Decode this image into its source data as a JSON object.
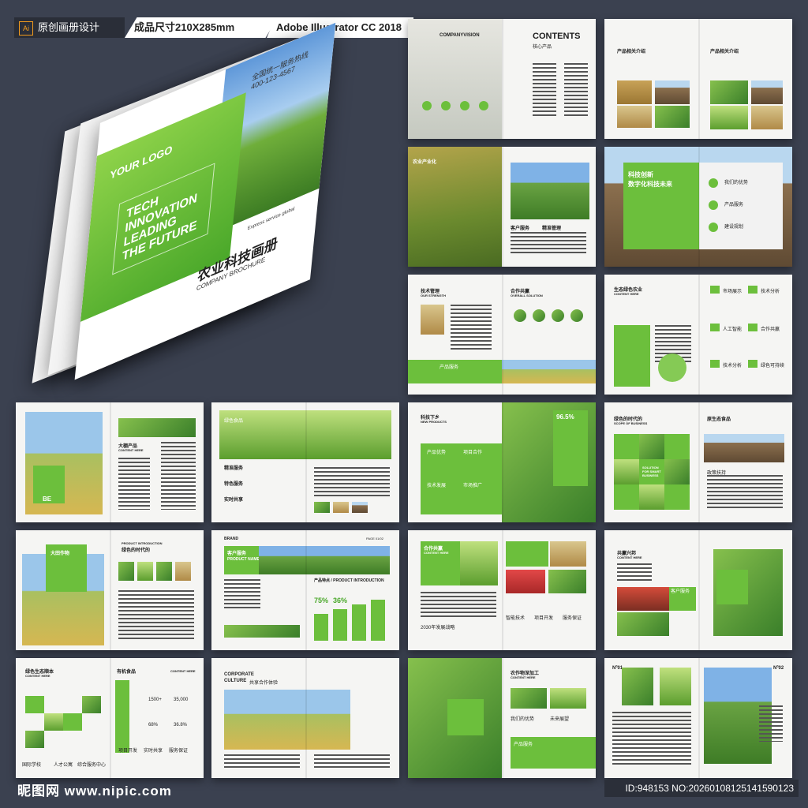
{
  "header": {
    "tag_ai": "Ai",
    "tag_design": "原创画册设计",
    "tag_size": "成品尺寸210X285mm",
    "tag_software": "Adobe Illustrator CC 2018"
  },
  "cover": {
    "logo": "YOUR LOGO",
    "slogan": "TECH INNOVATION LEADING THE FUTURE",
    "title_cn": "农业科技画册",
    "subtitle": "COMPANY BROCHURE",
    "phone_label": "全国统一服务热线",
    "phone": "400-123-4567",
    "express": "Express service global"
  },
  "spreads": {
    "s1": {
      "left_title": "COMPANYVISION",
      "right_title": "CONTENTS",
      "right_sub": "核心产品"
    },
    "s2": {
      "left_title": "产品相关介绍",
      "right_title": "产品相关介绍"
    },
    "s3": {
      "title": "农业产业化",
      "c1": "客户服务",
      "c2": "精准管理"
    },
    "s4": {
      "title1": "科技创新",
      "title2": "数字化科技未来",
      "i1": "我们的优势",
      "i2": "产品服务",
      "i3": "建设规划"
    },
    "s5": {
      "left_title": "技术管理",
      "left_sub": "OUR STRENGTH",
      "right_title": "合作共赢",
      "right_sub": "OVERALL SOLUTION",
      "label": "产品服务"
    },
    "s6": {
      "title": "生态绿色农业",
      "sub": "CONTENT HERE",
      "a": "市场展示",
      "b": "技术分析",
      "c": "人工智能",
      "d": "合作共赢",
      "e": "技术分析",
      "f": "绿色可持续"
    },
    "s7": {
      "title": "大棚产品",
      "sub": "CONTENT HERE",
      "badge": "BE"
    },
    "s8": {
      "title": "绿色食品",
      "a": "精准服务",
      "b": "特色服务",
      "c": "实时共享"
    },
    "s9": {
      "title": "科技下乡",
      "sub": "NEW PRODUCTS",
      "pct": "96.5%",
      "a": "产品优势",
      "b": "项目合作",
      "c": "技术发展",
      "d": "市场推广"
    },
    "s10": {
      "title": "绿色的时代的",
      "sub": "SCOPE OF BUSINESS",
      "right": "原生态食品",
      "solution": "SOLUTION FOR SMART BUSINESS",
      "r1": "政策扶持"
    },
    "s11": {
      "title": "大田作物",
      "right": "绿色的时代的",
      "right_sub": "PRODUCT INTRODUCTION"
    },
    "s12": {
      "brand": "BRAND",
      "t1": "客户服务",
      "t2": "PRODUCT NAME",
      "intro": "产品特点 / PRODUCT INTRODUCTION",
      "p1": "75%",
      "p2": "36%",
      "page": "PAGE 01/02"
    },
    "s13": {
      "title": "合作共赢",
      "sub": "CONTENT HERE",
      "l1": "2030年发展战略",
      "a": "智能技术",
      "b": "项目开发",
      "c": "服务保证"
    },
    "s14": {
      "title": "共赢兴邦",
      "sub": "CONTENT HERE",
      "l1": "客户服务"
    },
    "s15": {
      "title": "绿色生态顺本",
      "sub": "CONTENT HERE",
      "t2": "有机食品",
      "t2s": "CONTENT HERE",
      "n1": "1500+",
      "n2": "35,000",
      "n3": "68%",
      "n4": "36.8%",
      "a": "项目开发",
      "b": "实时共享",
      "c": "服务保证",
      "f1": "国际学校",
      "f2": "人才公寓",
      "f3": "综合服务中心"
    },
    "s16": {
      "title": "CORPORATE",
      "title2": "CULTURE",
      "cn": "共享合作体验"
    },
    "s17": {
      "title": "农作物深加工",
      "sub": "CONTENT HERE",
      "a": "我们的优势",
      "b": "未来展望",
      "c": "产品服务"
    },
    "s18": {
      "n1": "Nº01",
      "n2": "Nº02"
    }
  },
  "footer": {
    "watermark": "昵图网 www.nipic.com",
    "id_text": "ID:948153 NO:20260108125141590123"
  }
}
